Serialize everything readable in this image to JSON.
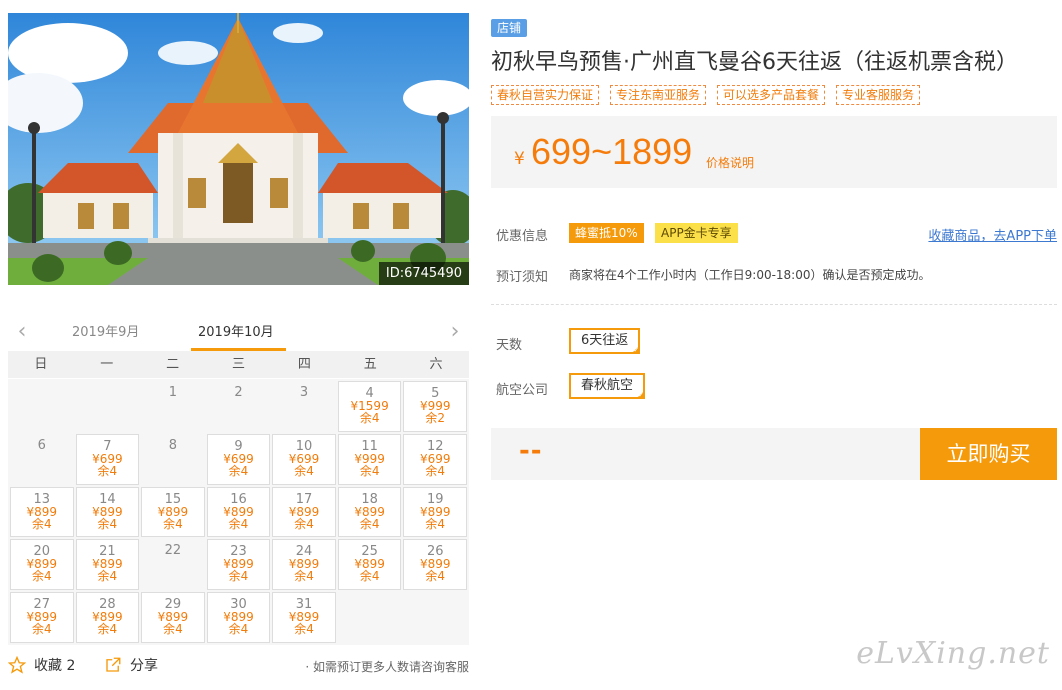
{
  "photo": {
    "id_label": "ID:6745490"
  },
  "calendar": {
    "prev_month": "2019年9月",
    "current_month": "2019年10月",
    "weekdays": [
      "日",
      "一",
      "二",
      "三",
      "四",
      "五",
      "六"
    ],
    "cells": [
      {
        "day": "",
        "price": "",
        "stock": ""
      },
      {
        "day": "",
        "price": "",
        "stock": ""
      },
      {
        "day": "1",
        "price": "",
        "stock": ""
      },
      {
        "day": "2",
        "price": "",
        "stock": ""
      },
      {
        "day": "3",
        "price": "",
        "stock": ""
      },
      {
        "day": "4",
        "price": "¥1599",
        "stock": "余4"
      },
      {
        "day": "5",
        "price": "¥999",
        "stock": "余2"
      },
      {
        "day": "6",
        "price": "",
        "stock": ""
      },
      {
        "day": "7",
        "price": "¥699",
        "stock": "余4"
      },
      {
        "day": "8",
        "price": "",
        "stock": ""
      },
      {
        "day": "9",
        "price": "¥699",
        "stock": "余4"
      },
      {
        "day": "10",
        "price": "¥699",
        "stock": "余4"
      },
      {
        "day": "11",
        "price": "¥999",
        "stock": "余4"
      },
      {
        "day": "12",
        "price": "¥699",
        "stock": "余4"
      },
      {
        "day": "13",
        "price": "¥899",
        "stock": "余4"
      },
      {
        "day": "14",
        "price": "¥899",
        "stock": "余4"
      },
      {
        "day": "15",
        "price": "¥899",
        "stock": "余4"
      },
      {
        "day": "16",
        "price": "¥899",
        "stock": "余4"
      },
      {
        "day": "17",
        "price": "¥899",
        "stock": "余4"
      },
      {
        "day": "18",
        "price": "¥899",
        "stock": "余4"
      },
      {
        "day": "19",
        "price": "¥899",
        "stock": "余4"
      },
      {
        "day": "20",
        "price": "¥899",
        "stock": "余4"
      },
      {
        "day": "21",
        "price": "¥899",
        "stock": "余4"
      },
      {
        "day": "22",
        "price": "",
        "stock": ""
      },
      {
        "day": "23",
        "price": "¥899",
        "stock": "余4"
      },
      {
        "day": "24",
        "price": "¥899",
        "stock": "余4"
      },
      {
        "day": "25",
        "price": "¥899",
        "stock": "余4"
      },
      {
        "day": "26",
        "price": "¥899",
        "stock": "余4"
      },
      {
        "day": "27",
        "price": "¥899",
        "stock": "余4"
      },
      {
        "day": "28",
        "price": "¥899",
        "stock": "余4"
      },
      {
        "day": "29",
        "price": "¥899",
        "stock": "余4"
      },
      {
        "day": "30",
        "price": "¥899",
        "stock": "余4"
      },
      {
        "day": "31",
        "price": "¥899",
        "stock": "余4"
      }
    ]
  },
  "bottom": {
    "favorite_label": "收藏 2",
    "share_label": "分享",
    "consult_note": "· 如需预订更多人数请咨询客服"
  },
  "product": {
    "shop_badge": "店铺",
    "title": "初秋早鸟预售·广州直飞曼谷6天往返（往返机票含税）",
    "tags": [
      "春秋自营实力保证",
      "专注东南亚服务",
      "可以选多产品套餐",
      "专业客服服务"
    ],
    "price_currency": "¥",
    "price_range": "699~1899",
    "price_note": "价格说明"
  },
  "offers": {
    "label": "优惠信息",
    "promo1": "蜂蜜抵10%",
    "promo2": "APP金卡专享",
    "app_link": "收藏商品，去APP下单"
  },
  "booking_notice": {
    "label": "预订须知",
    "text": "商家将在4个工作小时内（工作日9:00-18:00）确认是否预定成功。"
  },
  "options": {
    "days_label": "天数",
    "days_value": "6天往返",
    "airline_label": "航空公司",
    "airline_value": "春秋航空"
  },
  "buy": {
    "total": "--",
    "button": "立即购买"
  },
  "watermark": "eLvXing.net",
  "colors": {
    "accent": "#f59a0b",
    "price": "#f57c0b",
    "link": "#3d79d0",
    "badge": "#5a9fe6"
  }
}
